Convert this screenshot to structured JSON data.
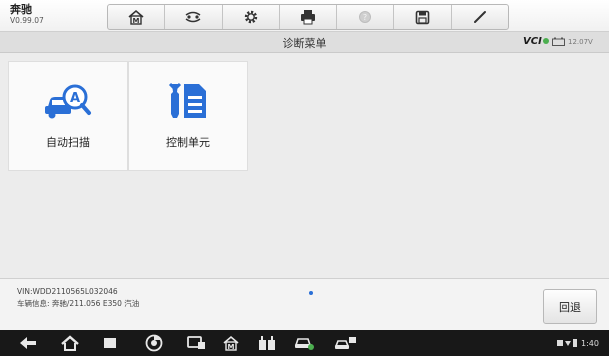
{
  "header": {
    "brand": "奔驰",
    "version": "V0.99.07"
  },
  "toolbar": {
    "buttons": [
      {
        "icon": "home-icon"
      },
      {
        "icon": "vehicle-swap-icon"
      },
      {
        "icon": "settings-gear-icon"
      },
      {
        "icon": "printer-icon"
      },
      {
        "icon": "help-icon"
      },
      {
        "icon": "save-icon"
      },
      {
        "icon": "pen-icon"
      }
    ]
  },
  "subheader": {
    "title": "诊断菜单",
    "vci_label": "VCI",
    "battery_voltage": "12.07V"
  },
  "tiles": [
    {
      "label": "自动扫描",
      "icon": "auto-scan-car-icon"
    },
    {
      "label": "控制单元",
      "icon": "control-unit-icon"
    }
  ],
  "info": {
    "vin": "VIN:WDD2110565L032046",
    "vehicle_info": "车辆信息: 奔驰/211.056 E350 汽油"
  },
  "actions": {
    "back_label": "回退"
  },
  "navbar": {
    "time": "1:40"
  },
  "colors": {
    "accent_blue": "#2a6fd6",
    "vci_green": "#4caf50"
  }
}
